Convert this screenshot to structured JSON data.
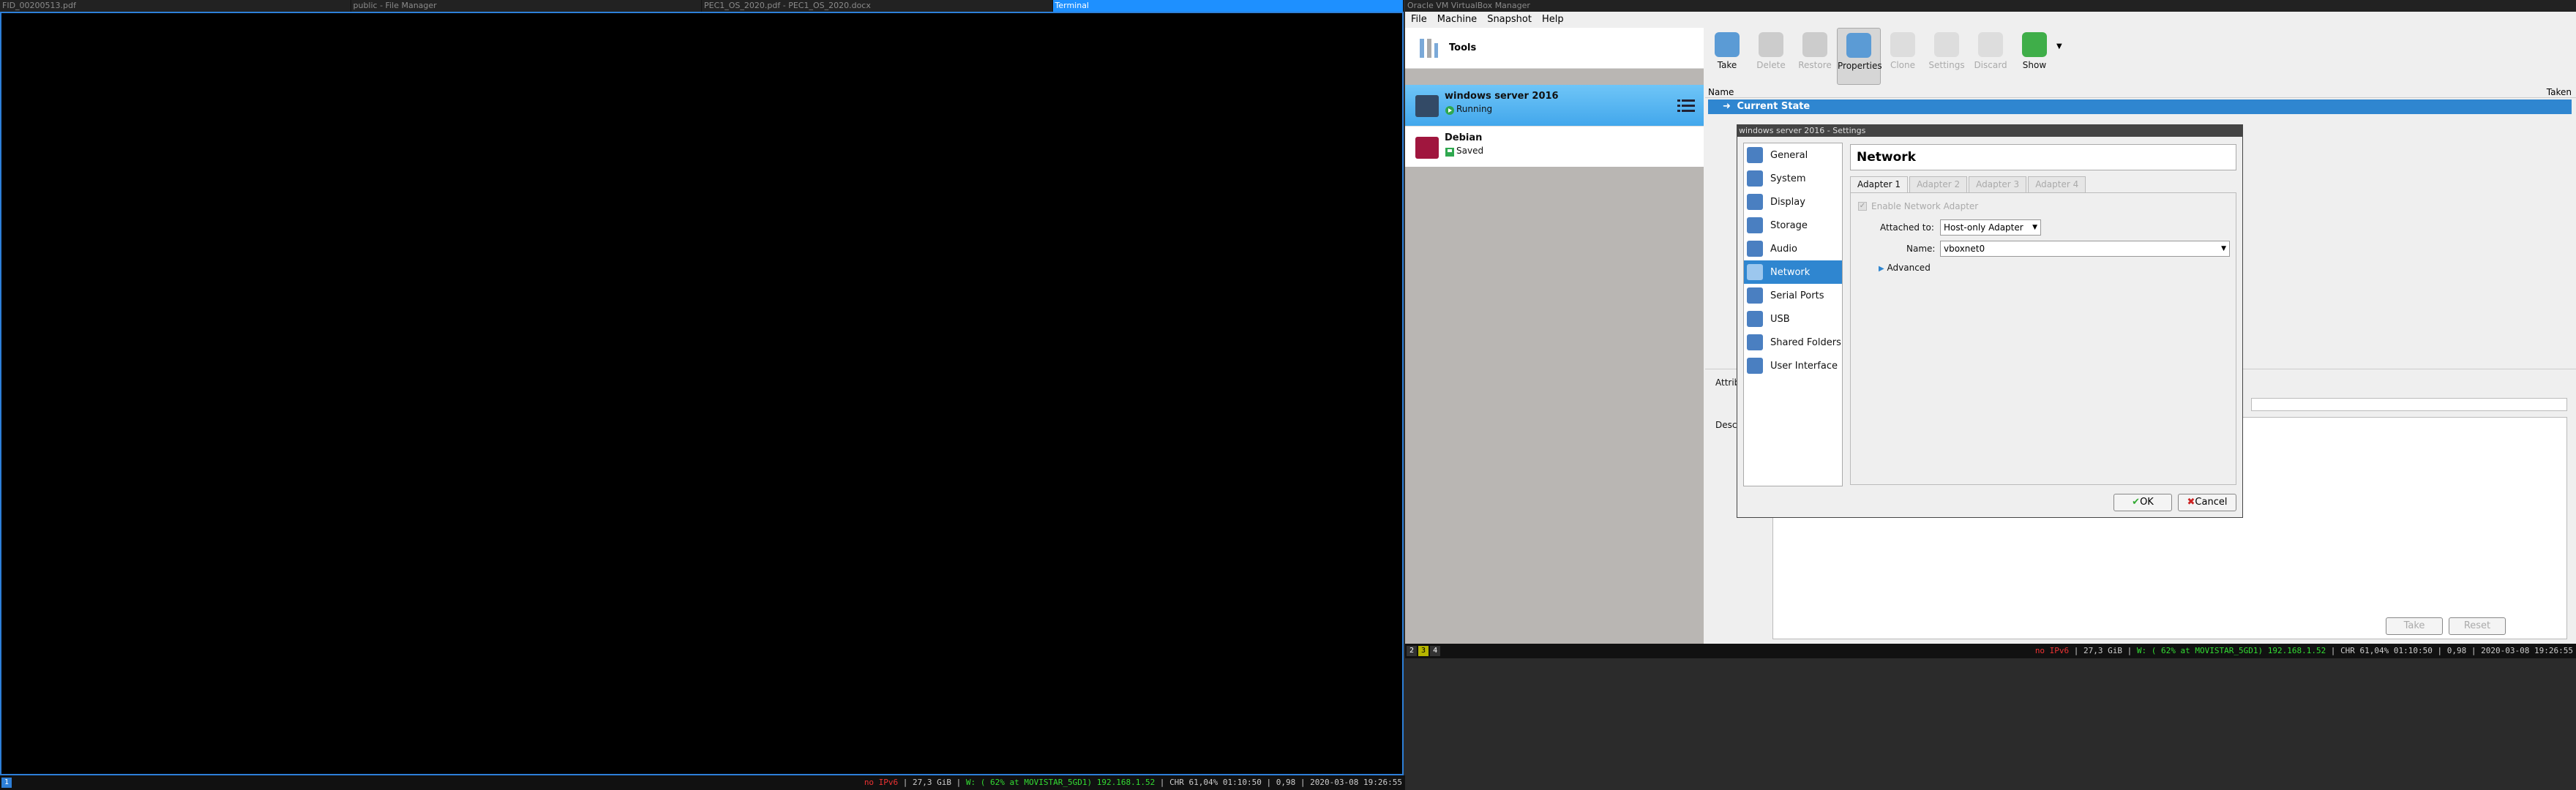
{
  "tabs": [
    "FID_00200513.pdf",
    "public - File Manager",
    "PEC1_OS_2020.pdf - PEC1_OS_2020.docx",
    "Terminal"
  ],
  "status": {
    "workspace": "1",
    "workspaces_right": [
      "2",
      "3",
      "4"
    ],
    "no_ipv6": "no IPv6",
    "disk": "27,3 GiB",
    "wifi": "W: ( 62% at MOVISTAR_5GD1) 192.168.1.52",
    "battery": "CHR 61,04% 01:10:50",
    "load": "0,98",
    "datetime": "2020-03-08 19:26:55"
  },
  "vbox": {
    "title": "Oracle VM VirtualBox Manager",
    "menu": [
      "File",
      "Machine",
      "Snapshot",
      "Help"
    ],
    "tools_label": "Tools",
    "vms": [
      {
        "name": "windows server 2016",
        "state": "Running"
      },
      {
        "name": "Debian",
        "state": "Saved"
      }
    ],
    "toolbar": [
      "Take",
      "Delete",
      "Restore",
      "Properties",
      "Clone",
      "Settings",
      "Discard",
      "Show"
    ],
    "snap_cols": {
      "name": "Name",
      "taken": "Taken"
    },
    "current_state": "Current State",
    "attr_label": "Attrib",
    "desc_label": "Descr",
    "bottom_take": "Take",
    "bottom_reset": "Reset"
  },
  "dialog": {
    "title": "windows server 2016 - Settings",
    "categories": [
      "General",
      "System",
      "Display",
      "Storage",
      "Audio",
      "Network",
      "Serial Ports",
      "USB",
      "Shared Folders",
      "User Interface"
    ],
    "page_title": "Network",
    "adapter_tabs": [
      "Adapter 1",
      "Adapter 2",
      "Adapter 3",
      "Adapter 4"
    ],
    "enable_label": "Enable Network Adapter",
    "attached_label": "Attached to:",
    "attached_value": "Host-only Adapter",
    "name_label": "Name:",
    "name_value": "vboxnet0",
    "advanced": "Advanced",
    "ok": "OK",
    "cancel": "Cancel"
  }
}
